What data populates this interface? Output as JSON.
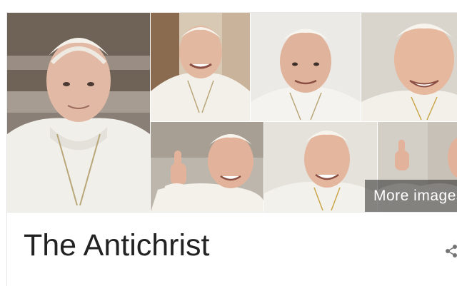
{
  "knowledge_panel": {
    "title": "The Antichrist",
    "more_images_label": "More images",
    "share_icon": "share-icon"
  },
  "images": [
    {
      "name": "image-1",
      "alt": ""
    },
    {
      "name": "image-2",
      "alt": ""
    },
    {
      "name": "image-3",
      "alt": ""
    },
    {
      "name": "image-4",
      "alt": ""
    },
    {
      "name": "image-5",
      "alt": ""
    },
    {
      "name": "image-6",
      "alt": ""
    },
    {
      "name": "image-7",
      "alt": ""
    }
  ],
  "colors": {
    "title_text": "#222222",
    "overlay": "#282828",
    "border": "#e6e6e6"
  }
}
